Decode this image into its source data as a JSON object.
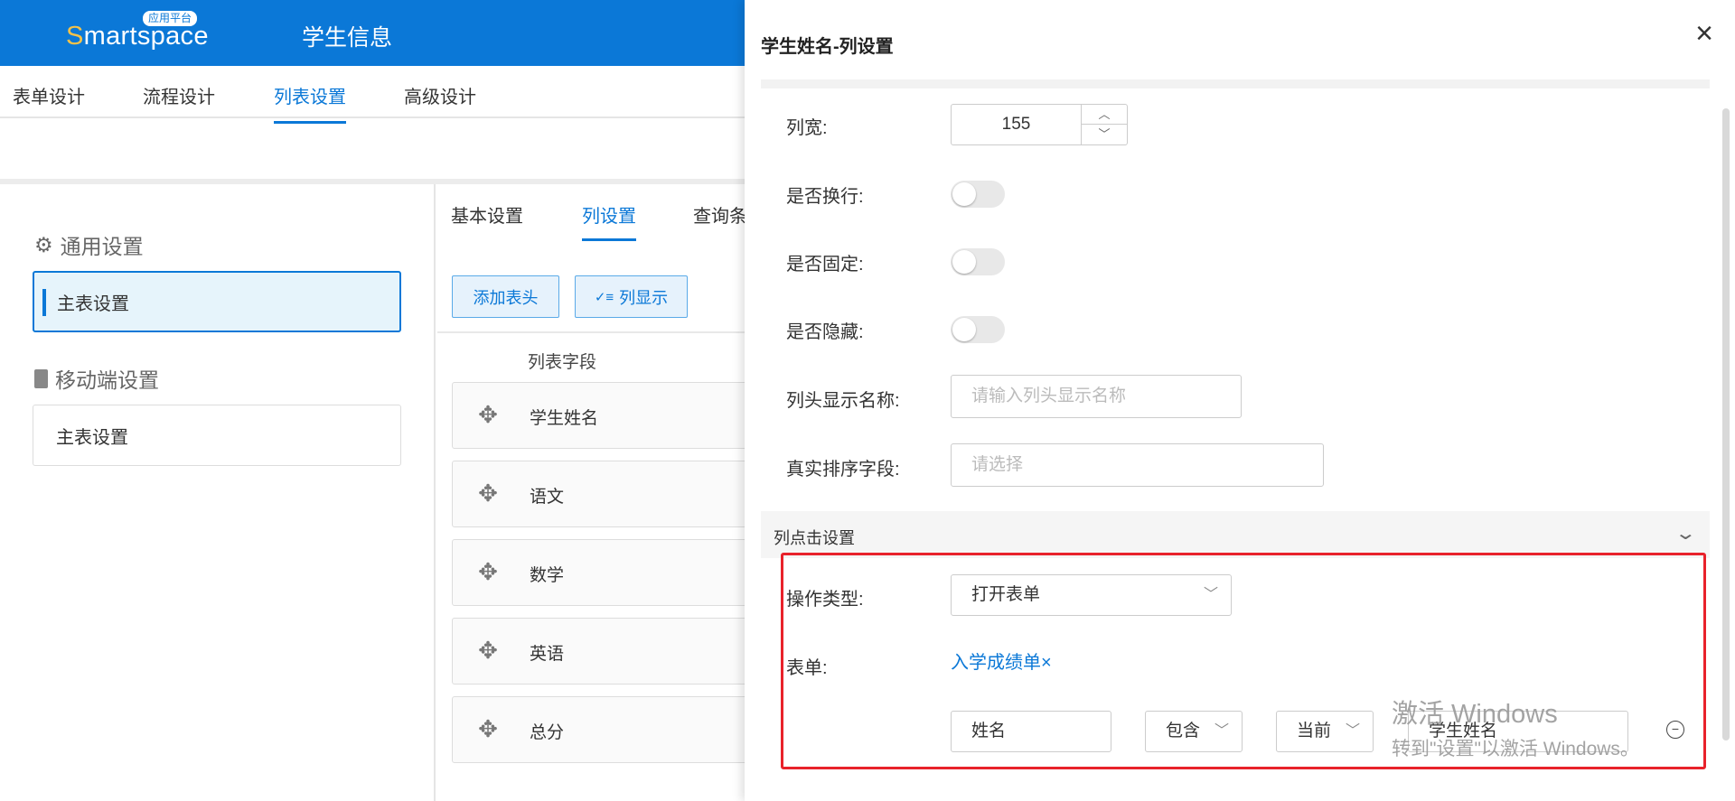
{
  "header": {
    "logo_text": "Smartspace",
    "logo_badge": "应用平台",
    "app_title": "学生信息"
  },
  "top_tabs": [
    {
      "label": "表单设计"
    },
    {
      "label": "流程设计"
    },
    {
      "label": "列表设置",
      "active": true
    },
    {
      "label": "高级设计"
    }
  ],
  "left_panel": {
    "general_section": "通用设置",
    "general_item": "主表设置",
    "mobile_section": "移动端设置",
    "mobile_item": "主表设置"
  },
  "middle_panel": {
    "tabs": [
      {
        "label": "基本设置"
      },
      {
        "label": "列设置",
        "active": true
      },
      {
        "label": "查询条"
      }
    ],
    "add_header_button": "添加表头",
    "column_display_button": "列显示",
    "column_header": "列表字段",
    "fields": [
      "学生姓名",
      "语文",
      "数学",
      "英语",
      "总分"
    ]
  },
  "drawer": {
    "title": "学生姓名-列设置",
    "column_width_label": "列宽:",
    "column_width_value": "155",
    "wrap_label": "是否换行:",
    "wrap_on": false,
    "fixed_label": "是否固定:",
    "fixed_on": false,
    "hidden_label": "是否隐藏:",
    "hidden_on": false,
    "header_name_label": "列头显示名称:",
    "header_name_placeholder": "请输入列头显示名称",
    "sort_field_label": "真实排序字段:",
    "sort_field_placeholder": "请选择",
    "click_section_title": "列点击设置",
    "op_type_label": "操作类型:",
    "op_type_value": "打开表单",
    "form_label": "表单:",
    "form_value": "入学成绩单",
    "condition": {
      "field": "姓名",
      "operator": "包含",
      "scope": "当前",
      "value": "学生姓名"
    }
  },
  "watermark": {
    "line1": "激活 Windows",
    "line2": "转到\"设置\"以激活 Windows。"
  },
  "colors": {
    "primary": "#0b78d7",
    "highlight_border": "#e8222b"
  }
}
